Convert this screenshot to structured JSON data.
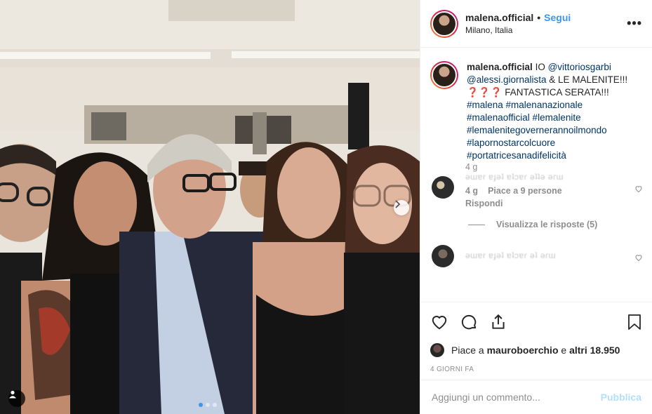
{
  "post": {
    "username": "malena.official",
    "separator": "•",
    "follow_label": "Segui",
    "location": "Milano, Italia",
    "more_label": "•••"
  },
  "caption": {
    "username": "malena.official",
    "text_lead": "IO",
    "mention_1": "@vittoriosgarbi",
    "mention_2": "@alessi.giornalista",
    "text_mid": "& LE MALENITE!!!",
    "emoji_placeholder": "❓❓❓",
    "text_tail": "FANTASTICA SERATA!!!",
    "hashtags": [
      "#malena #malenanazionale",
      "#malenaofficial #lemalenite",
      "#lemalenitegovernerannoilmondo",
      "#lapornostarcolcuore",
      "#portatricesanadifelicità"
    ]
  },
  "comments": [
    {
      "time": "4 g",
      "blurred_text": "ǝɯɐɾ ɐɟǝʇ ɐʇɔɐɾ ǝʇʇǝ ǝɾɯ"
    },
    {
      "time": "4 g",
      "likes": "Piace a 9 persone",
      "reply_label": "Rispondi",
      "view_replies": "Visualizza le risposte (5)"
    },
    {
      "blurred_text": "ǝɯɐɾ ɐɟǝʇ ɐʇɔɐɾ ǝʇ ǝɾɯ"
    }
  ],
  "likes": {
    "prefix": "Piace a",
    "user": "mauroboerchio",
    "joiner": "e",
    "others": "altri 18.950"
  },
  "posted_ago": "4 giorni fa",
  "comment_box": {
    "placeholder": "Aggiungi un commento...",
    "publish_label": "Pubblica"
  },
  "colors": {
    "link": "#003569",
    "follow": "#3897f0",
    "publish_disabled": "#b2dffc",
    "muted": "#8e8e8e"
  },
  "icons": [
    "heart-icon",
    "comment-icon",
    "share-icon",
    "bookmark-icon",
    "user-tag-icon",
    "chevron-right-icon"
  ]
}
